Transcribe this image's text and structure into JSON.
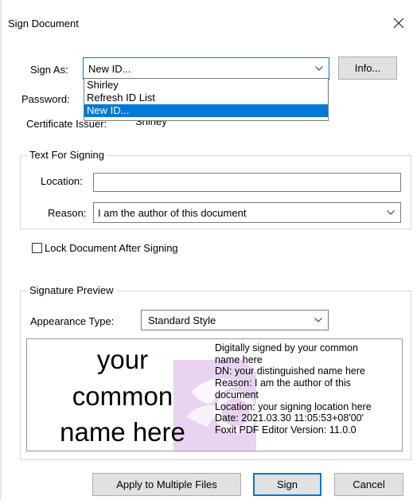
{
  "dialog": {
    "title": "Sign Document",
    "close_icon": "close-icon"
  },
  "sign_as": {
    "label": "Sign As:",
    "value": "New ID...",
    "info_button": "Info...",
    "options": [
      "Shirley",
      "Refresh ID List",
      "New ID..."
    ],
    "selected_index": 2
  },
  "password": {
    "label": "Password:"
  },
  "certificate": {
    "label": "Certificate Issuer:",
    "value": "Shirley"
  },
  "text_for_signing": {
    "legend": "Text For Signing",
    "location_label": "Location:",
    "location_value": "",
    "reason_label": "Reason:",
    "reason_value": "I am the author of this document"
  },
  "lock": {
    "label": "Lock Document After Signing",
    "checked": false
  },
  "signature_preview": {
    "legend": "Signature Preview",
    "appearance_label": "Appearance Type:",
    "appearance_value": "Standard Style",
    "name_lines": [
      "your",
      "common",
      "name here"
    ],
    "details": [
      "Digitally signed by your common",
      "name here",
      "DN: your distinguished name here",
      "Reason: I am the author of this",
      "document",
      "Location: your signing location here",
      "Date: 2021.03.30 11:05:53+08'00'",
      "Foxit PDF Editor Version: 11.0.0"
    ]
  },
  "buttons": {
    "apply_multiple": "Apply to Multiple Files",
    "sign": "Sign",
    "cancel": "Cancel"
  },
  "colors": {
    "accent": "#0078d7",
    "button_face": "#e1e1e1",
    "watermark": "#d9b8e6"
  }
}
